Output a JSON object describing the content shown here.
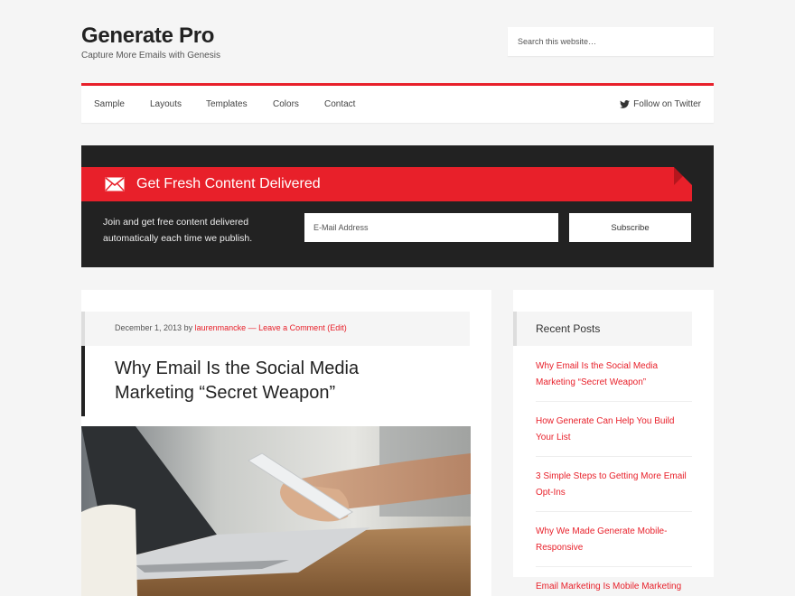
{
  "header": {
    "site_title": "Generate Pro",
    "site_description": "Capture More Emails with Genesis",
    "search_placeholder": "Search this website…"
  },
  "nav": {
    "items": [
      "Sample",
      "Layouts",
      "Templates",
      "Colors",
      "Contact"
    ],
    "twitter_label": "Follow on Twitter"
  },
  "optin": {
    "title": "Get Fresh Content Delivered",
    "text": "Join and get free content delivered automatically each time we publish.",
    "email_placeholder": "E-Mail Address",
    "button_label": "Subscribe"
  },
  "post": {
    "date": "December 1, 2013",
    "by": "by",
    "author": "laurenmancke",
    "separator": "—",
    "comments": "Leave a Comment",
    "edit": "(Edit)",
    "title": "Why Email Is the Social Media Marketing “Secret Weapon”"
  },
  "sidebar": {
    "widget_title": "Recent Posts",
    "recent_posts": [
      "Why Email Is the Social Media Marketing “Secret Weapon”",
      "How Generate Can Help You Build Your List",
      "3 Simple Steps to Getting More Email Opt-Ins",
      "Why We Made Generate Mobile-Responsive",
      "Email Marketing Is Mobile Marketing"
    ]
  },
  "colors": {
    "accent": "#e8202a",
    "dark": "#222222",
    "background": "#f5f5f5"
  }
}
